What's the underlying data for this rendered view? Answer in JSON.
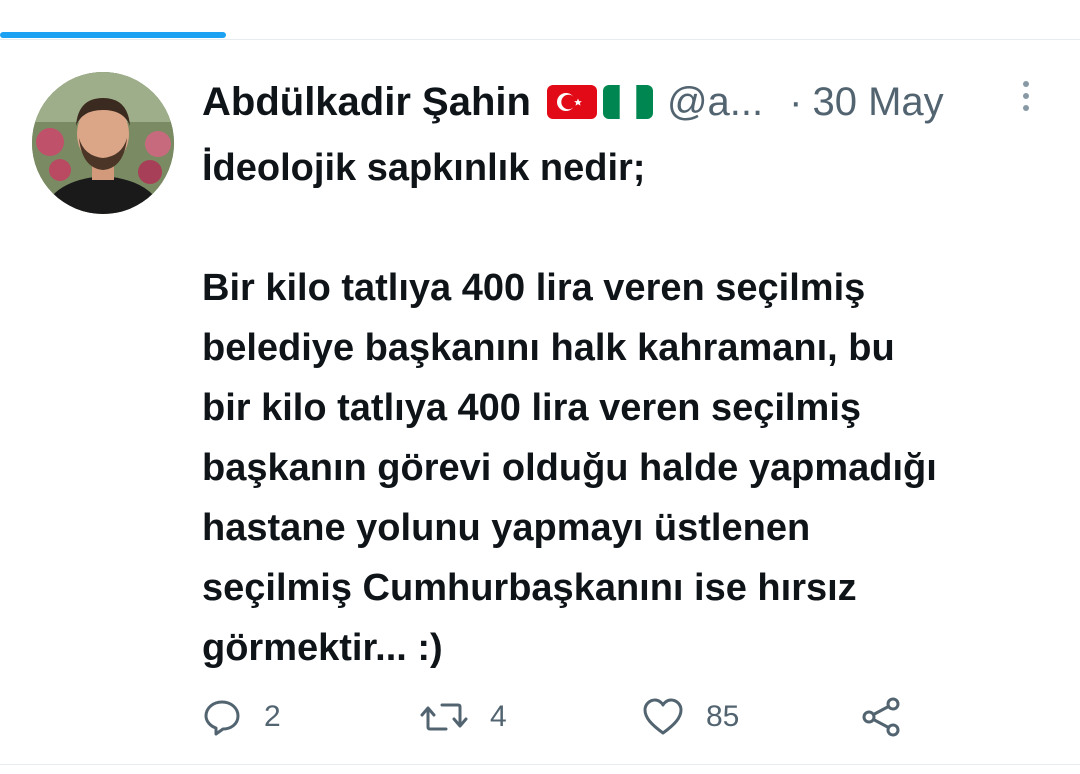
{
  "tweet": {
    "author": {
      "display_name": "Abdülkadir Şahin",
      "flags": [
        "turkey-flag",
        "nigeria-flag"
      ],
      "handle": "@a...",
      "avatar_icon": "profile-photo"
    },
    "separator": "·",
    "date": "30 May",
    "more_icon": "vertical-ellipsis-icon",
    "text_lines": [
      "İdeolojik sapkınlık nedir;",
      "",
      "Bir kilo tatlıya 400 lira veren seçilmiş",
      "belediye başkanını halk kahramanı, bu",
      "bir kilo tatlıya 400 lira veren seçilmiş",
      "başkanın görevi olduğu halde yapmadığı",
      "hastane yolunu yapmayı üstlenen",
      "seçilmiş Cumhurbaşkanını ise hırsız",
      "görmektir... :)"
    ],
    "actions": {
      "reply": {
        "icon": "reply-icon",
        "count": "2"
      },
      "retweet": {
        "icon": "retweet-icon",
        "count": "4"
      },
      "like": {
        "icon": "heart-icon",
        "count": "85"
      },
      "share": {
        "icon": "share-icon"
      }
    }
  },
  "colors": {
    "accent": "#1da1f2",
    "text_primary": "#0f1419",
    "text_secondary": "#536471",
    "divider": "#e6ecf0"
  }
}
